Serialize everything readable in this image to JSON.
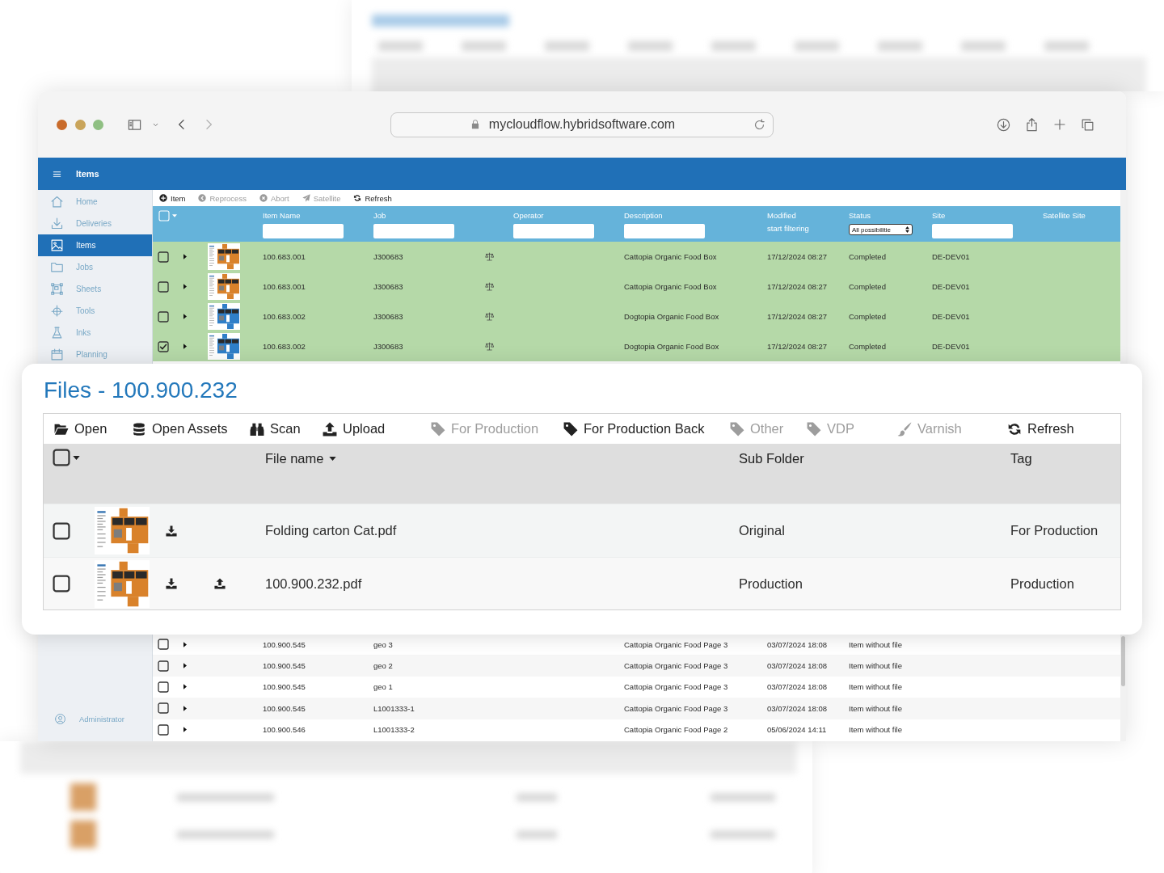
{
  "browser": {
    "url": "mycloudflow.hybridsoftware.com",
    "back_disabled": false,
    "forward_disabled": true
  },
  "app_bar": {
    "title": "Items"
  },
  "sidebar": {
    "items": [
      {
        "label": "Home",
        "selected": false
      },
      {
        "label": "Deliveries",
        "selected": false
      },
      {
        "label": "Items",
        "selected": true
      },
      {
        "label": "Jobs",
        "selected": false
      },
      {
        "label": "Sheets",
        "selected": false
      },
      {
        "label": "Tools",
        "selected": false
      },
      {
        "label": "Inks",
        "selected": false
      },
      {
        "label": "Planning",
        "selected": false
      }
    ],
    "user": "Administrator"
  },
  "toolbar": [
    {
      "label": "Item",
      "disabled": false
    },
    {
      "label": "Reprocess",
      "disabled": true
    },
    {
      "label": "Abort",
      "disabled": true
    },
    {
      "label": "Satellite",
      "disabled": true
    },
    {
      "label": "Refresh",
      "disabled": false
    }
  ],
  "items_table": {
    "select_all": {
      "checked": false
    },
    "columns": [
      {
        "label": "Item Name",
        "kind": "field"
      },
      {
        "label": "Job",
        "kind": "field"
      },
      {
        "label": "Operator",
        "kind": "field"
      },
      {
        "label": "Description",
        "kind": "field"
      },
      {
        "label": "Modified",
        "kind": "hint",
        "hint": "start filtering"
      },
      {
        "label": "Status",
        "kind": "select",
        "value": "All possibilitie"
      },
      {
        "label": "Site",
        "kind": "field"
      },
      {
        "label": "Satellite Site",
        "kind": "none"
      }
    ],
    "upper_rows": [
      {
        "checked": false,
        "highlighted": true,
        "has_file": true,
        "color": "#d9822b",
        "item_name": "100.683.001",
        "job": "J300683",
        "description": "Cattopia Organic Food Box",
        "modified": "17/12/2024 08:27",
        "status": "Completed",
        "site": "DE-DEV01"
      },
      {
        "checked": false,
        "highlighted": true,
        "has_file": true,
        "color": "#d9822b",
        "item_name": "100.683.001",
        "job": "J300683",
        "description": "Cattopia Organic Food Box",
        "modified": "17/12/2024 08:27",
        "status": "Completed",
        "site": "DE-DEV01"
      },
      {
        "checked": false,
        "highlighted": true,
        "has_file": true,
        "color": "#2f7fc8",
        "item_name": "100.683.002",
        "job": "J300683",
        "description": "Dogtopia Organic Food Box",
        "modified": "17/12/2024 08:27",
        "status": "Completed",
        "site": "DE-DEV01"
      },
      {
        "checked": true,
        "highlighted": true,
        "has_file": true,
        "color": "#2f7fc8",
        "item_name": "100.683.002",
        "job": "J300683",
        "description": "Dogtopia Organic Food Box",
        "modified": "17/12/2024 08:27",
        "status": "Completed",
        "site": "DE-DEV01"
      }
    ],
    "lower_rows": [
      {
        "checked": false,
        "highlighted": false,
        "has_file": false,
        "item_name": "100.900.545",
        "job": "geo 3",
        "description": "Cattopia Organic Food Page 3",
        "modified": "03/07/2024 18:08",
        "status": "Item without file"
      },
      {
        "checked": false,
        "highlighted": false,
        "has_file": false,
        "item_name": "100.900.545",
        "job": "geo 2",
        "description": "Cattopia Organic Food Page 3",
        "modified": "03/07/2024 18:08",
        "status": "Item without file"
      },
      {
        "checked": false,
        "highlighted": false,
        "has_file": false,
        "item_name": "100.900.545",
        "job": "geo 1",
        "description": "Cattopia Organic Food Page 3",
        "modified": "03/07/2024 18:08",
        "status": "Item without file"
      },
      {
        "checked": false,
        "highlighted": false,
        "has_file": false,
        "item_name": "100.900.545",
        "job": "L1001333-1",
        "description": "Cattopia Organic Food Page 3",
        "modified": "03/07/2024 18:08",
        "status": "Item without file"
      },
      {
        "checked": false,
        "highlighted": false,
        "has_file": false,
        "item_name": "100.900.546",
        "job": "L1001333-2",
        "description": "Cattopia Organic Food Page 2",
        "modified": "05/06/2024 14:11",
        "status": "Item without file"
      }
    ]
  },
  "files_panel": {
    "title": "Files - 100.900.232",
    "toolbar": [
      {
        "label": "Open",
        "disabled": false
      },
      {
        "label": "Open Assets",
        "disabled": false
      },
      {
        "label": "Scan",
        "disabled": false
      },
      {
        "label": "Upload",
        "disabled": false
      },
      {
        "label": "For Production",
        "disabled": true
      },
      {
        "label": "For Production Back",
        "disabled": false
      },
      {
        "label": "Other",
        "disabled": true
      },
      {
        "label": "VDP",
        "disabled": true
      },
      {
        "label": "Varnish",
        "disabled": true
      },
      {
        "label": "Refresh",
        "disabled": false
      }
    ],
    "select_all": {
      "checked": false
    },
    "columns": [
      {
        "label": "File name",
        "sorted": true
      },
      {
        "label": "Sub Folder",
        "sorted": false
      },
      {
        "label": "Tag",
        "sorted": false
      }
    ],
    "rows": [
      {
        "checked": false,
        "color": "#d9822b",
        "upload": false,
        "file_name": "Folding carton Cat.pdf",
        "sub_folder": "Original",
        "tag": "For Production"
      },
      {
        "checked": false,
        "color": "#d9822b",
        "upload": true,
        "file_name": "100.900.232.pdf",
        "sub_folder": "Production",
        "tag": "Production"
      }
    ]
  }
}
